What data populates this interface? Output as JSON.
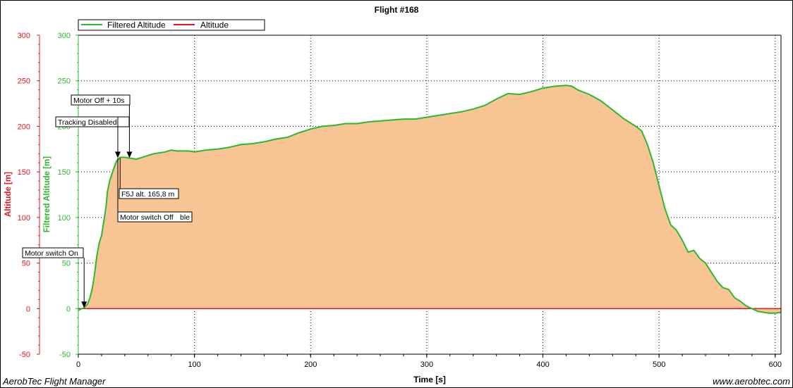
{
  "footer": {
    "app_name": "AerobTec Flight Manager",
    "website": "www.aerobtec.com"
  },
  "chart_data": {
    "type": "area",
    "title": "Flight #168",
    "xlabel": "Time [s]",
    "ylabel_left": "Altitude [m]",
    "ylabel_right": "Filtered Altitude [m]",
    "xlim": [
      0,
      605
    ],
    "ylim": [
      -50,
      300
    ],
    "x_ticks": [
      0,
      100,
      200,
      300,
      400,
      500,
      600
    ],
    "y_ticks": [
      -50,
      0,
      50,
      100,
      150,
      200,
      250,
      300
    ],
    "grid": true,
    "legend_position": "top-left",
    "colors": {
      "filtered": "#2db82d",
      "filtered_fill": "#f9c494",
      "altitude": "#e8141e",
      "left_axis": "#e8141e",
      "right_axis": "#2db82d",
      "grid": "#000000"
    },
    "series": [
      {
        "name": "Filtered Altitude",
        "x": [
          0,
          3,
          5,
          8,
          10,
          12,
          14,
          16,
          18,
          20,
          22,
          24,
          25,
          27,
          30,
          33,
          36,
          40,
          45,
          50,
          55,
          60,
          65,
          70,
          75,
          80,
          85,
          90,
          95,
          100,
          110,
          120,
          130,
          140,
          150,
          160,
          170,
          180,
          190,
          200,
          210,
          220,
          230,
          240,
          250,
          260,
          270,
          280,
          290,
          300,
          310,
          320,
          330,
          340,
          350,
          360,
          370,
          380,
          390,
          400,
          410,
          420,
          425,
          430,
          440,
          450,
          460,
          470,
          480,
          485,
          490,
          495,
          500,
          505,
          510,
          515,
          520,
          525,
          530,
          535,
          540,
          545,
          550,
          555,
          560,
          565,
          570,
          575,
          580,
          585,
          590,
          595,
          600,
          605
        ],
        "values": [
          -2,
          0,
          1,
          5,
          12,
          22,
          38,
          58,
          72,
          80,
          96,
          113,
          128,
          140,
          152,
          162,
          166,
          166,
          165,
          164,
          166,
          168,
          170,
          171,
          172,
          174,
          173,
          173,
          173,
          172,
          174,
          175,
          177,
          180,
          181,
          183,
          186,
          188,
          193,
          197,
          200,
          201,
          203,
          203,
          205,
          206,
          207,
          208,
          208,
          210,
          212,
          214,
          216,
          219,
          223,
          230,
          236,
          235,
          238,
          242,
          244,
          245,
          244,
          240,
          235,
          228,
          218,
          208,
          200,
          195,
          180,
          160,
          135,
          110,
          92,
          86,
          75,
          62,
          64,
          55,
          50,
          40,
          30,
          23,
          21,
          12,
          8,
          3,
          0,
          -3,
          -4,
          -5,
          -5,
          -4
        ]
      },
      {
        "name": "Altitude",
        "x": [
          0,
          605
        ],
        "values": [
          0,
          0
        ]
      }
    ],
    "annotations": [
      {
        "label": "Motor switch On",
        "x": 5,
        "y": 0
      },
      {
        "label": "Tracking Disabled",
        "x": 34,
        "y": 166
      },
      {
        "label": "Motor Off + 10s",
        "x": 44,
        "y": 166
      },
      {
        "label": "F5J alt. 165,8 m",
        "x": 36,
        "y": 166
      },
      {
        "label": "Motor switch Off",
        "x": 34,
        "y": 166
      },
      {
        "label": "Tracking Enable",
        "x": 34,
        "y": 166
      }
    ]
  }
}
